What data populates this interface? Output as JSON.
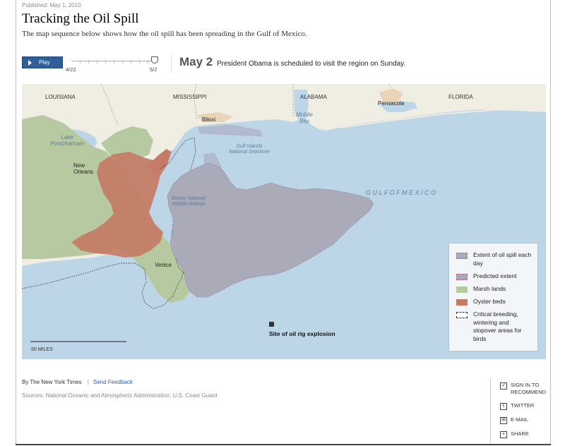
{
  "header": {
    "published": "Published: May 1, 2010",
    "title": "Tracking the Oil Spill",
    "subtitle": "The map sequence below shows how the oil spill has been spreading in the Gulf of Mexico."
  },
  "controls": {
    "play_label": "Play",
    "slider_start": "4/22",
    "slider_end": "5/2",
    "slider_position": 1.0,
    "date": "May 2",
    "caption": "President Obama is scheduled to visit the region on Sunday."
  },
  "map": {
    "states": [
      "LOUISIANA",
      "MISSISSIPPI",
      "ALABAMA",
      "FLORIDA"
    ],
    "cities": [
      "Biloxi",
      "Pensacola",
      "New Orleans",
      "Venice"
    ],
    "water": {
      "lake": "Lake Pontchartrain",
      "bay": "Mobile Bay",
      "gulf": "G U L F   O F   M E X I C O"
    },
    "places": {
      "gulf_islands": "Gulf Islands National Seashore",
      "breton": "Breton National Wildlife Refuge"
    },
    "rig_label": "Site of oil rig explosion",
    "scale_label": "50 MILES",
    "colors": {
      "water": "#bcd6e8",
      "land": "#f0ede3",
      "marsh": "#b6c9a1",
      "oyster": "#c47b64",
      "oil": "#aaaab9",
      "oil_predicted": "#a7a6bd",
      "urban": "#ead4b8"
    }
  },
  "legend": {
    "items": [
      {
        "label": "Extent of oil spill each day",
        "color": "#aaaab9"
      },
      {
        "label": "Predicted extent",
        "color": "#a7a6bd"
      },
      {
        "label": "Marsh lands",
        "color": "#b6c9a1"
      },
      {
        "label": "Oyster beds",
        "color": "#c47b64"
      },
      {
        "label": "Critical breeding, wintering and stopover areas for birds",
        "color": "#ffffff"
      }
    ]
  },
  "footer": {
    "byline": "By The New York Times",
    "feedback": "Send Feedback",
    "sources": "Sources: National Oceanic and Atmospheric Administration; U.S. Coast Guard"
  },
  "share": {
    "items": [
      {
        "label": "SIGN IN TO RECOMMEND",
        "icon": "check-icon"
      },
      {
        "label": "TWITTER",
        "icon": "twitter-icon"
      },
      {
        "label": "E-MAIL",
        "icon": "email-icon"
      },
      {
        "label": "SHARE",
        "icon": "share-icon"
      }
    ]
  }
}
